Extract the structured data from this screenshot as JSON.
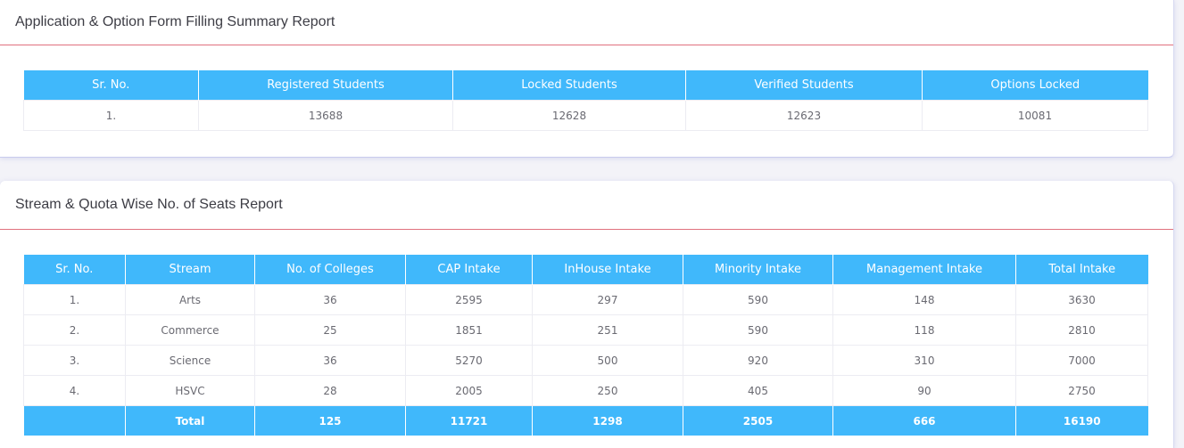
{
  "summary": {
    "title": "Application & Option Form Filling Summary Report",
    "headers": [
      "Sr. No.",
      "Registered Students",
      "Locked Students",
      "Verified Students",
      "Options Locked"
    ],
    "rows": [
      [
        "1.",
        "13688",
        "12628",
        "12623",
        "10081"
      ]
    ]
  },
  "seats": {
    "title": "Stream & Quota Wise No. of Seats Report",
    "headers": [
      "Sr. No.",
      "Stream",
      "No. of Colleges",
      "CAP Intake",
      "InHouse Intake",
      "Minority Intake",
      "Management Intake",
      "Total Intake"
    ],
    "rows": [
      [
        "1.",
        "Arts",
        "36",
        "2595",
        "297",
        "590",
        "148",
        "3630"
      ],
      [
        "2.",
        "Commerce",
        "25",
        "1851",
        "251",
        "590",
        "118",
        "2810"
      ],
      [
        "3.",
        "Science",
        "36",
        "5270",
        "500",
        "920",
        "310",
        "7000"
      ],
      [
        "4.",
        "HSVC",
        "28",
        "2005",
        "250",
        "405",
        "90",
        "2750"
      ]
    ],
    "total": [
      "",
      "Total",
      "125",
      "11721",
      "1298",
      "2505",
      "666",
      "16190"
    ]
  },
  "colors": {
    "header_bg": "#40b8fb",
    "divider": "#e0707e"
  }
}
